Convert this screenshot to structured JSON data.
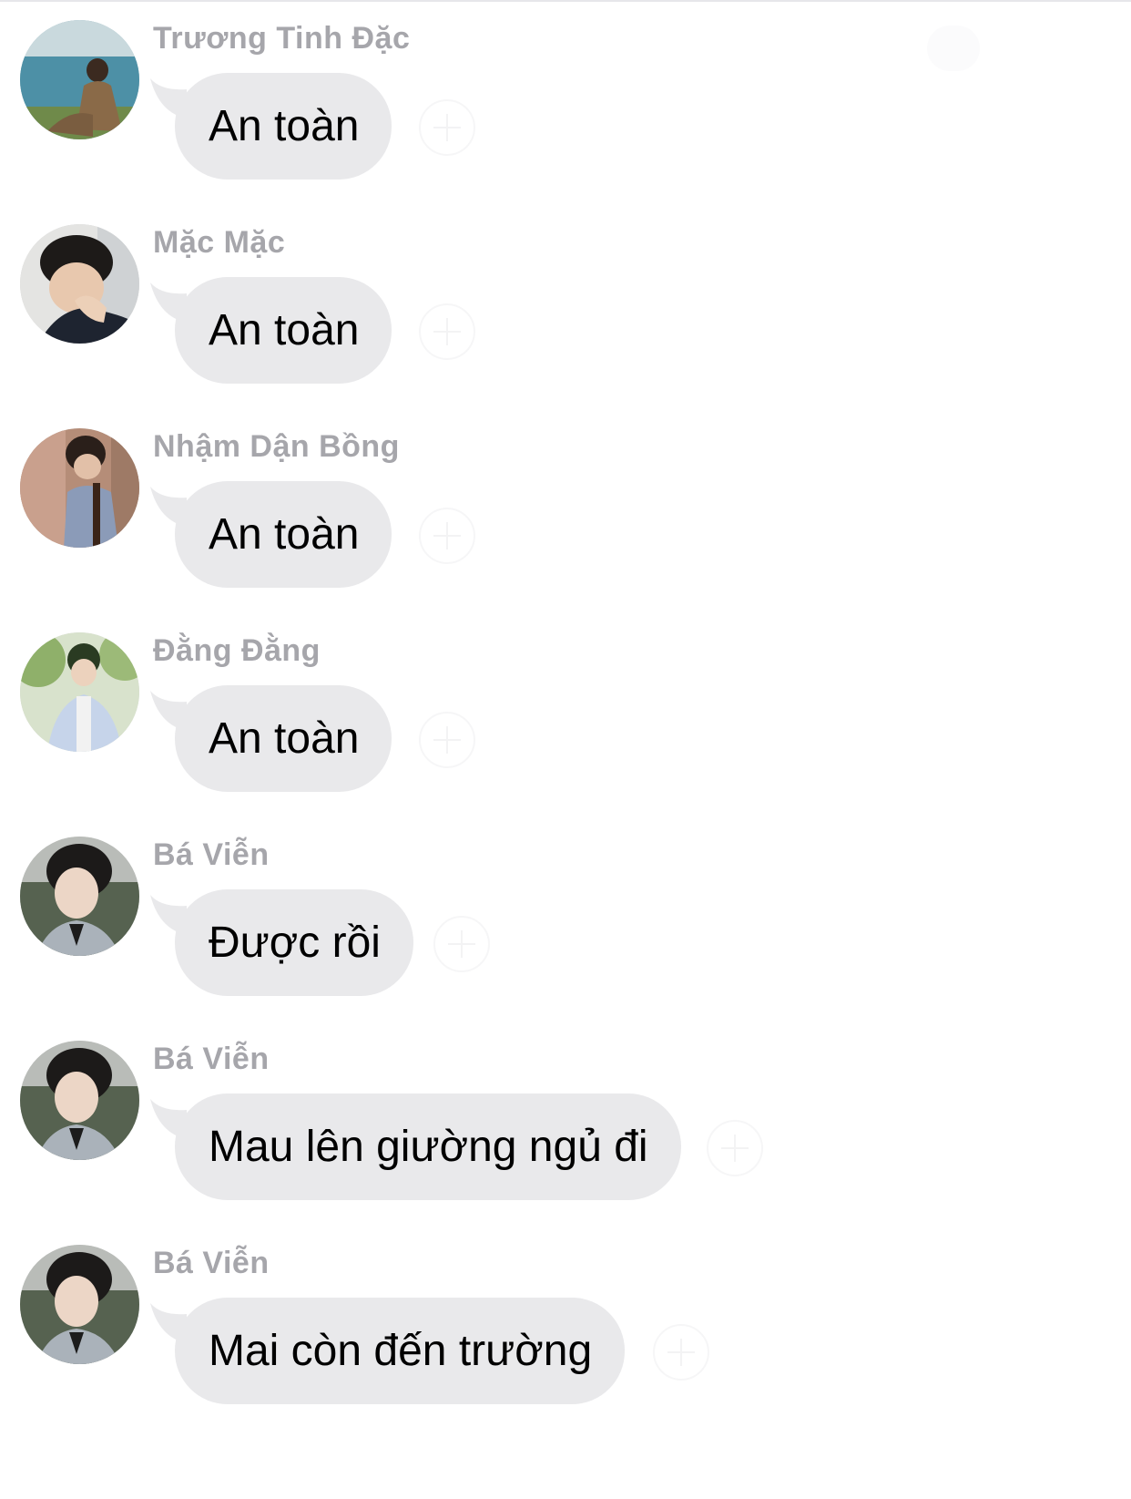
{
  "messages": [
    {
      "sender": "Trương Tinh Đặc",
      "text": "An toàn",
      "avatar": "avatar-seaside-photo"
    },
    {
      "sender": "Mặc Mặc",
      "text": "An toàn",
      "avatar": "avatar-sleeping-photo"
    },
    {
      "sender": "Nhậm Dận Bồng",
      "text": "An toàn",
      "avatar": "avatar-violin-photo"
    },
    {
      "sender": "Đằng Đằng",
      "text": "An toàn",
      "avatar": "avatar-garden-photo"
    },
    {
      "sender": "Bá Viễn",
      "text": "Được rồi",
      "avatar": "avatar-portrait-photo"
    },
    {
      "sender": "Bá Viễn",
      "text": "Mau lên giường ngủ đi",
      "avatar": "avatar-portrait-photo"
    },
    {
      "sender": "Bá Viễn",
      "text": "Mai còn đến trường",
      "avatar": "avatar-portrait-photo"
    }
  ],
  "colors": {
    "bubble": "#e9e9eb",
    "sender_name": "#a6a6ab",
    "message_text": "#000000",
    "background": "#ffffff"
  },
  "icons": {
    "reaction": "add-reaction-icon"
  }
}
